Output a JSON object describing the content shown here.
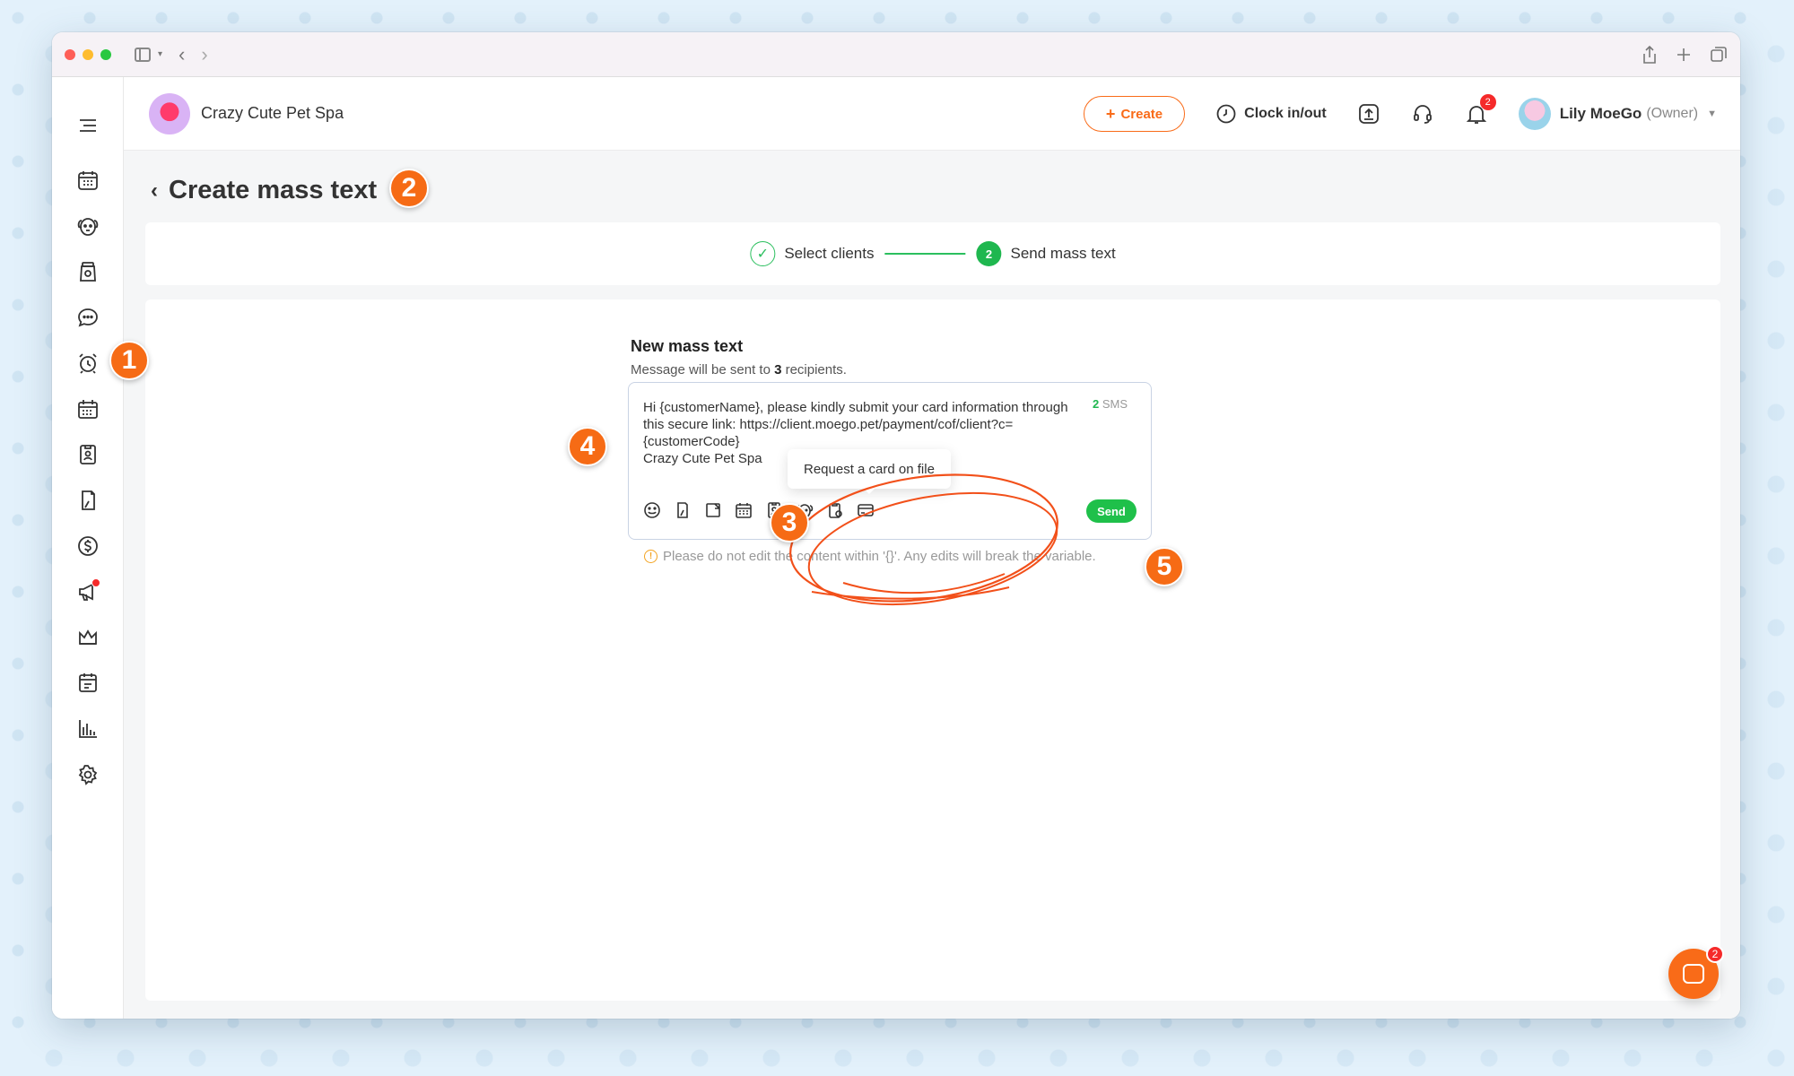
{
  "header": {
    "business_name": "Crazy Cute Pet Spa",
    "create_label": "Create",
    "clock_label": "Clock in/out",
    "notification_count": "2",
    "user_name": "Lily MoeGo",
    "user_role": "(Owner)"
  },
  "page": {
    "title": "Create mass text"
  },
  "steps": [
    {
      "label": "Select clients",
      "state": "done"
    },
    {
      "number": "2",
      "label": "Send mass text",
      "state": "active"
    }
  ],
  "compose": {
    "title": "New mass text",
    "recipients_prefix": "Message will be sent to ",
    "recipients_count": "3",
    "recipients_suffix": " recipients.",
    "message": "Hi {customerName}, please kindly submit your card information through this secure link: https://client.moego.pet/payment/cof/client?c={customerCode}\nCrazy Cute Pet Spa",
    "sms_count": "2",
    "sms_label": " SMS",
    "send_label": "Send",
    "tooltip": "Request a card on file",
    "warning": "Please do not edit the content within '{}'. Any edits will break the variable."
  },
  "toolbar_icons": [
    "emoji-icon",
    "agreement-icon",
    "note-icon",
    "appointment-icon",
    "pet-owner-icon",
    "pet-icon",
    "intake-form-icon",
    "card-on-file-icon"
  ],
  "sidebar_icons": [
    "calendar-icon",
    "pets-icon",
    "retail-icon",
    "message-icon",
    "reminder-icon",
    "booking-icon",
    "client-card-icon",
    "agreement-icon",
    "payment-icon",
    "marketing-icon",
    "membership-icon",
    "online-booking-icon",
    "reports-icon",
    "settings-icon"
  ],
  "annotations": [
    "1",
    "2",
    "3",
    "4",
    "5"
  ],
  "chat_badge": "2",
  "colors": {
    "accent": "#f96b18",
    "success": "#1fb74f",
    "annotation": "#f66b15"
  }
}
